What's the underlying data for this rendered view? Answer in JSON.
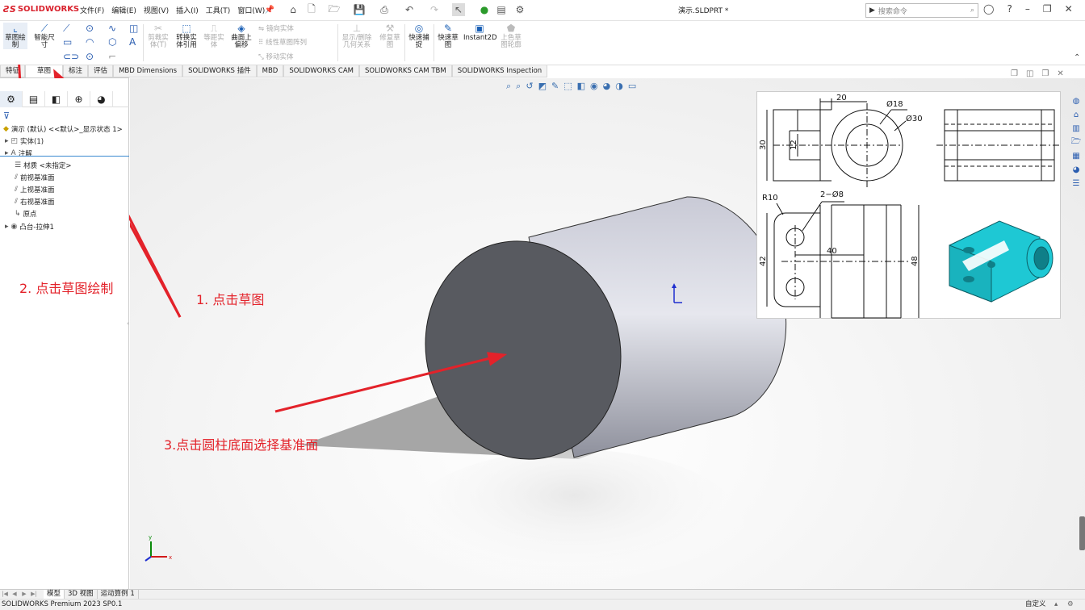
{
  "app": {
    "name": "SOLIDWORKS",
    "doc_title": "演示.SLDPRT *"
  },
  "menus": [
    "文件(F)",
    "编辑(E)",
    "视图(V)",
    "插入(I)",
    "工具(T)",
    "窗口(W)"
  ],
  "search": {
    "placeholder": "搜索命令"
  },
  "ribbon": {
    "sketch": "草图绘\n制",
    "smart_dim": "智能尺\n寸",
    "trim": "剪裁实\n体(T)",
    "convert": "转换实\n体引用",
    "offset_entity": "等距实\n体",
    "offset_surface": "曲面上\n偏移",
    "mirror": "镜向实体",
    "linear_pattern": "线性草图阵列",
    "move": "移动实体",
    "relations": "显示/删除\n几何关系",
    "repair": "修复草\n图",
    "quick_snap": "快速捕\n捉",
    "rapid_sketch": "快速草\n图",
    "instant2d": "Instant2D",
    "shaded_sketch": "上色草\n图轮廓"
  },
  "tabs": [
    "特征",
    "草图",
    "标注",
    "评估",
    "MBD Dimensions",
    "SOLIDWORKS 插件",
    "MBD",
    "SOLIDWORKS CAM",
    "SOLIDWORKS CAM TBM",
    "SOLIDWORKS Inspection"
  ],
  "tree": {
    "root": "演示 (默认) <<默认>_显示状态 1>",
    "items": [
      "实体(1)",
      "注解",
      "材质 <未指定>",
      "前视基准面",
      "上视基准面",
      "右视基准面",
      "原点",
      "凸台-拉伸1"
    ]
  },
  "drawing": {
    "dim20": "20",
    "d18": "Ø18",
    "d30": "Ø30",
    "dim30": "30",
    "dim12": "12",
    "r10": "R10",
    "holes": "2−Ø8",
    "dim40": "40",
    "dim42": "42",
    "dim48": "48"
  },
  "annotations": [
    "2. 点击草图绘制",
    "1. 点击草图",
    "3.点击圆柱底面选择基准面"
  ],
  "bottom_tabs": [
    "模型",
    "3D 视图",
    "运动算例 1"
  ],
  "status": {
    "left": "SOLIDWORKS Premium 2023 SP0.1",
    "right": "自定义"
  },
  "colors": {
    "arrow": "#e3222a",
    "cylinder_face": "#585a60",
    "part_cyan": "#1ec8d4"
  }
}
